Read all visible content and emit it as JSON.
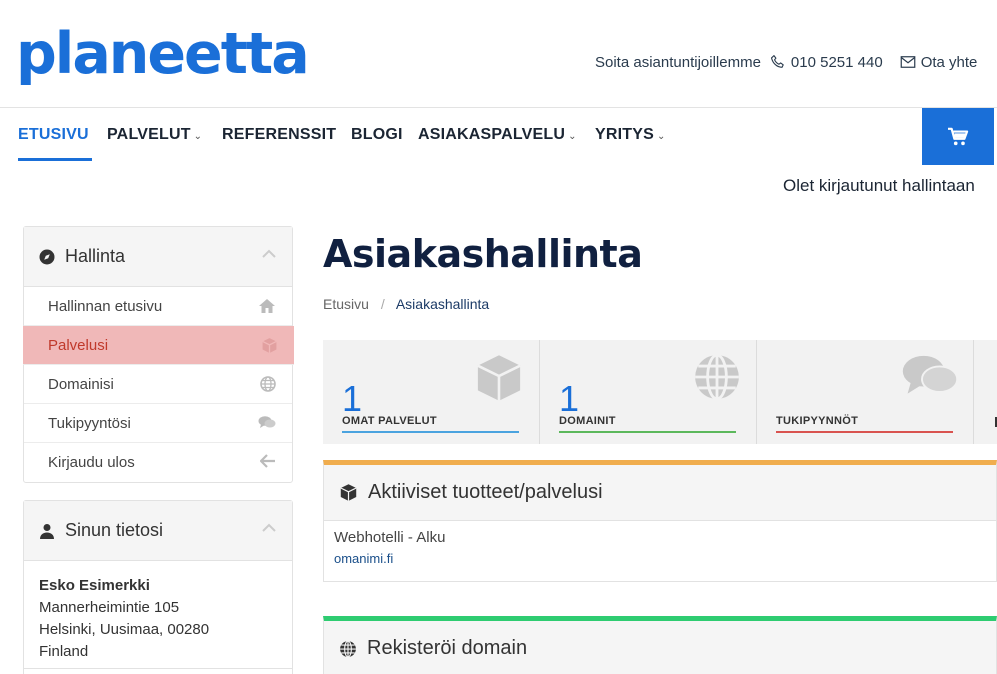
{
  "header": {
    "logo": "planeetta",
    "call_text": "Soita asiantuntijoillemme",
    "phone": "010 5251 440",
    "contact_link": "Ota yhte"
  },
  "nav": {
    "items": [
      {
        "label": "ETUSIVU",
        "dropdown": false,
        "active": true
      },
      {
        "label": "PALVELUT",
        "dropdown": true
      },
      {
        "label": "REFERENSSIT",
        "dropdown": false
      },
      {
        "label": "BLOGI",
        "dropdown": false
      },
      {
        "label": "ASIAKASPALVELU",
        "dropdown": true
      },
      {
        "label": "YRITYS",
        "dropdown": true
      }
    ],
    "chevron": "⌄",
    "logged_in_text": "Olet kirjautunut hallintaan"
  },
  "sidebar": {
    "admin_panel": {
      "title": "Hallinta",
      "items": [
        {
          "label": "Hallinnan etusivu",
          "icon": "home-icon"
        },
        {
          "label": "Palvelusi",
          "icon": "cube-icon",
          "active": true
        },
        {
          "label": "Domainisi",
          "icon": "globe-icon"
        },
        {
          "label": "Tukipyyntösi",
          "icon": "comments-icon"
        },
        {
          "label": "Kirjaudu ulos",
          "icon": "arrow-left-icon"
        }
      ]
    },
    "info_panel": {
      "title": "Sinun tietosi",
      "name": "Esko Esimerkki",
      "address": "Mannerheimintie 105",
      "city": "Helsinki, Uusimaa, 00280",
      "country": "Finland"
    }
  },
  "main": {
    "title": "Asiakashallinta",
    "breadcrumb": {
      "home": "Etusivu",
      "separator": "/",
      "current": "Asiakashallinta"
    },
    "stats": [
      {
        "value": "1",
        "label": "OMAT PALVELUT",
        "color": "#4aa3df",
        "icon": "cube-icon"
      },
      {
        "value": "1",
        "label": "DOMAINIT",
        "color": "#5cb85c",
        "icon": "globe-icon"
      },
      {
        "value": "",
        "label": "TUKIPYYNNÖT",
        "color": "#d9534f",
        "icon": "comments-icon"
      }
    ],
    "active_products": {
      "title": "Aktiiviset tuotteet/palvelusi",
      "accent": "#f0ad4e",
      "product": "Webhotelli - Alku",
      "domain": "omanimi.fi"
    },
    "register_domain": {
      "title": "Rekisteröi domain",
      "accent": "#2ecc71"
    }
  },
  "colors": {
    "brand": "#1a6fd8",
    "active_menu_bg": "#f0b8b8",
    "active_menu_text": "#c0392b"
  }
}
